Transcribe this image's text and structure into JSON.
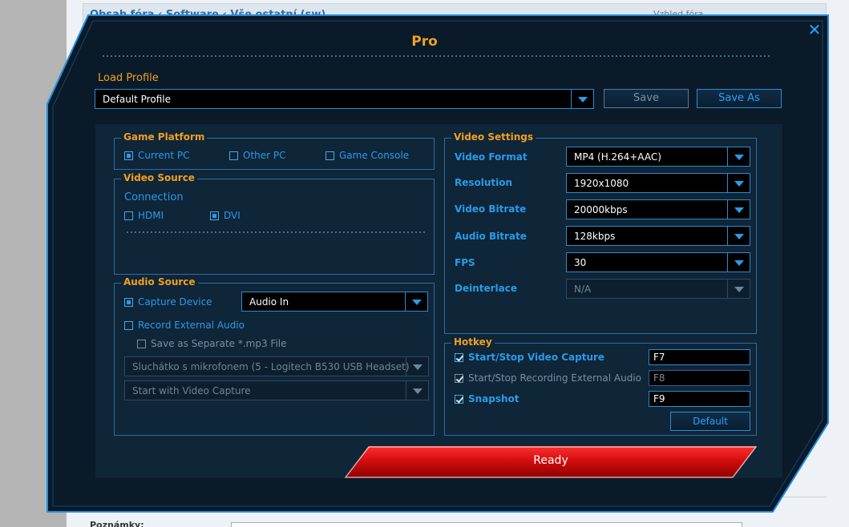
{
  "background": {
    "breadcrumb": "Obsah fóra ‹ Software ‹ Vše ostatní (sw)",
    "view_label": "Vzhled fóra",
    "note_label": "Poznámky:"
  },
  "dialog": {
    "title": "Pro",
    "close_glyph": "✕"
  },
  "profile": {
    "label": "Load Profile",
    "selected": "Default Profile",
    "save_label": "Save",
    "save_as_label": "Save As"
  },
  "game_platform": {
    "title": "Game Platform",
    "options": [
      {
        "label": "Current PC",
        "selected": true
      },
      {
        "label": "Other PC",
        "selected": false
      },
      {
        "label": "Game Console",
        "selected": false
      }
    ]
  },
  "video_source": {
    "title": "Video Source",
    "connection_label": "Connection",
    "options": [
      {
        "label": "HDMI",
        "selected": false
      },
      {
        "label": "DVI",
        "selected": true
      }
    ]
  },
  "audio_source": {
    "title": "Audio Source",
    "capture_device_label": "Capture Device",
    "capture_device_value": "Audio In",
    "record_external_label": "Record External Audio",
    "separate_mp3_label": "Save as Separate *.mp3 File",
    "device_dropdown": "Sluchátko s mikrofonem (5 - Logitech B530 USB Headset)",
    "start_dropdown": "Start with Video Capture"
  },
  "video_settings": {
    "title": "Video Settings",
    "rows": [
      {
        "label": "Video Format",
        "value": "MP4 (H.264+AAC)"
      },
      {
        "label": "Resolution",
        "value": "1920x1080"
      },
      {
        "label": "Video Bitrate",
        "value": "20000kbps"
      },
      {
        "label": "Audio Bitrate",
        "value": "128kbps"
      },
      {
        "label": "FPS",
        "value": "30"
      },
      {
        "label": "Deinterlace",
        "value": "N/A"
      }
    ]
  },
  "hotkey": {
    "title": "Hotkey",
    "rows": [
      {
        "label": "Start/Stop Video Capture",
        "key": "F7",
        "checked": true
      },
      {
        "label": "Start/Stop Recording External Audio",
        "key": "F8",
        "checked": true
      },
      {
        "label": "Snapshot",
        "key": "F9",
        "checked": true
      }
    ],
    "default_label": "Default"
  },
  "ready_label": "Ready",
  "colors": {
    "accent_orange": "#f0a020",
    "accent_blue": "#2a9be8",
    "dialog_bg": "#0b1a28",
    "ready_red": "#d40d0d"
  }
}
